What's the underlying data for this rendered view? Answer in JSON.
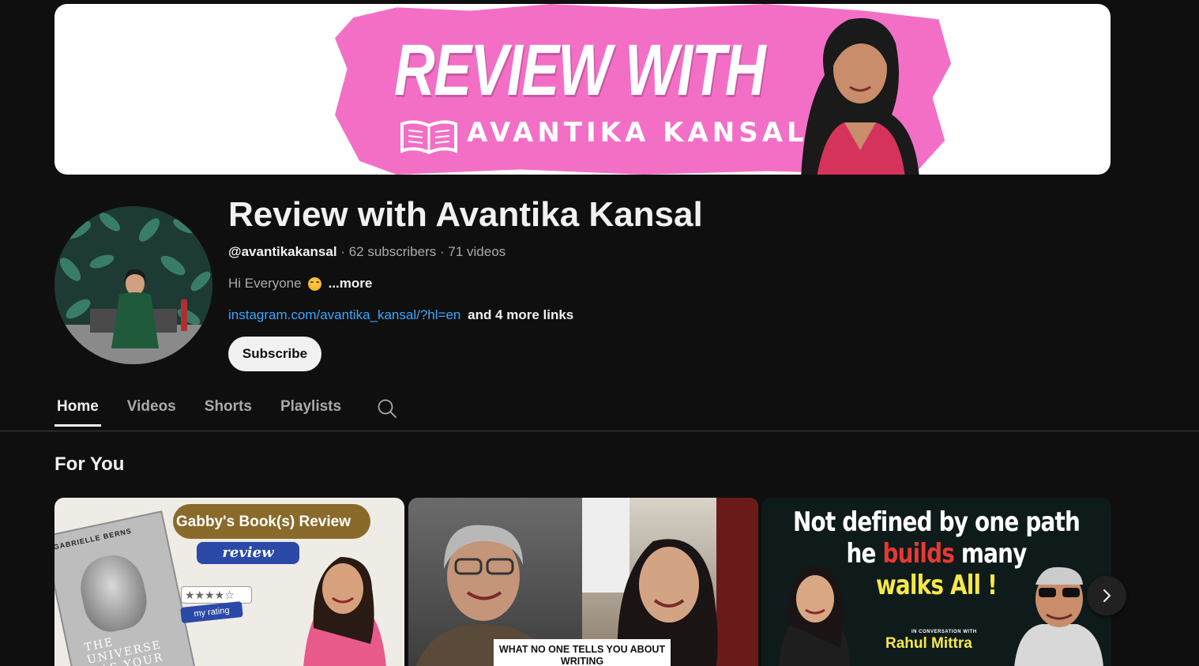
{
  "banner": {
    "title": "REVIEW WITH",
    "subtitle": "AVANTIKA KANSAL"
  },
  "channel": {
    "name": "Review with Avantika Kansal",
    "handle": "@avantikakansal",
    "subscribers": "62 subscribers",
    "videos": "71 videos",
    "separator": "·",
    "description": "Hi Everyone",
    "more_label": "...more",
    "link_text": "instagram.com/avantika_kansal/?hl=en",
    "more_links": "and 4 more links",
    "subscribe_label": "Subscribe"
  },
  "tabs": [
    {
      "label": "Home",
      "active": true
    },
    {
      "label": "Videos",
      "active": false
    },
    {
      "label": "Shorts",
      "active": false
    },
    {
      "label": "Playlists",
      "active": false
    }
  ],
  "section": {
    "title": "For You"
  },
  "videos": [
    {
      "thumb_header": "Gabby's Book(s) Review",
      "thumb_review": "review",
      "thumb_rating_label": "my rating",
      "thumb_rating_stars": "★★★★☆",
      "book_author": "GABRIELLE BERNS",
      "book_title": "THE UNIVERSE HAS YOUR BACK"
    },
    {
      "thumb_caption": "WHAT NO ONE TELLS YOU ABOUT WRITING"
    },
    {
      "thumb_line1": "Not defined by one path",
      "thumb_line2_a": "he ",
      "thumb_line2_b": "builds",
      "thumb_line2_c": " many",
      "thumb_line3": "walks All !",
      "thumb_inconv": "IN CONVERSATION WITH",
      "thumb_name": "Rahul Mittra"
    }
  ],
  "colors": {
    "background": "#0f0f0f",
    "link": "#3ea6ff",
    "banner_pink": "#f36fc6"
  },
  "icons": {
    "tab_search": "search-icon",
    "carousel_next": "chevron-right-icon"
  }
}
